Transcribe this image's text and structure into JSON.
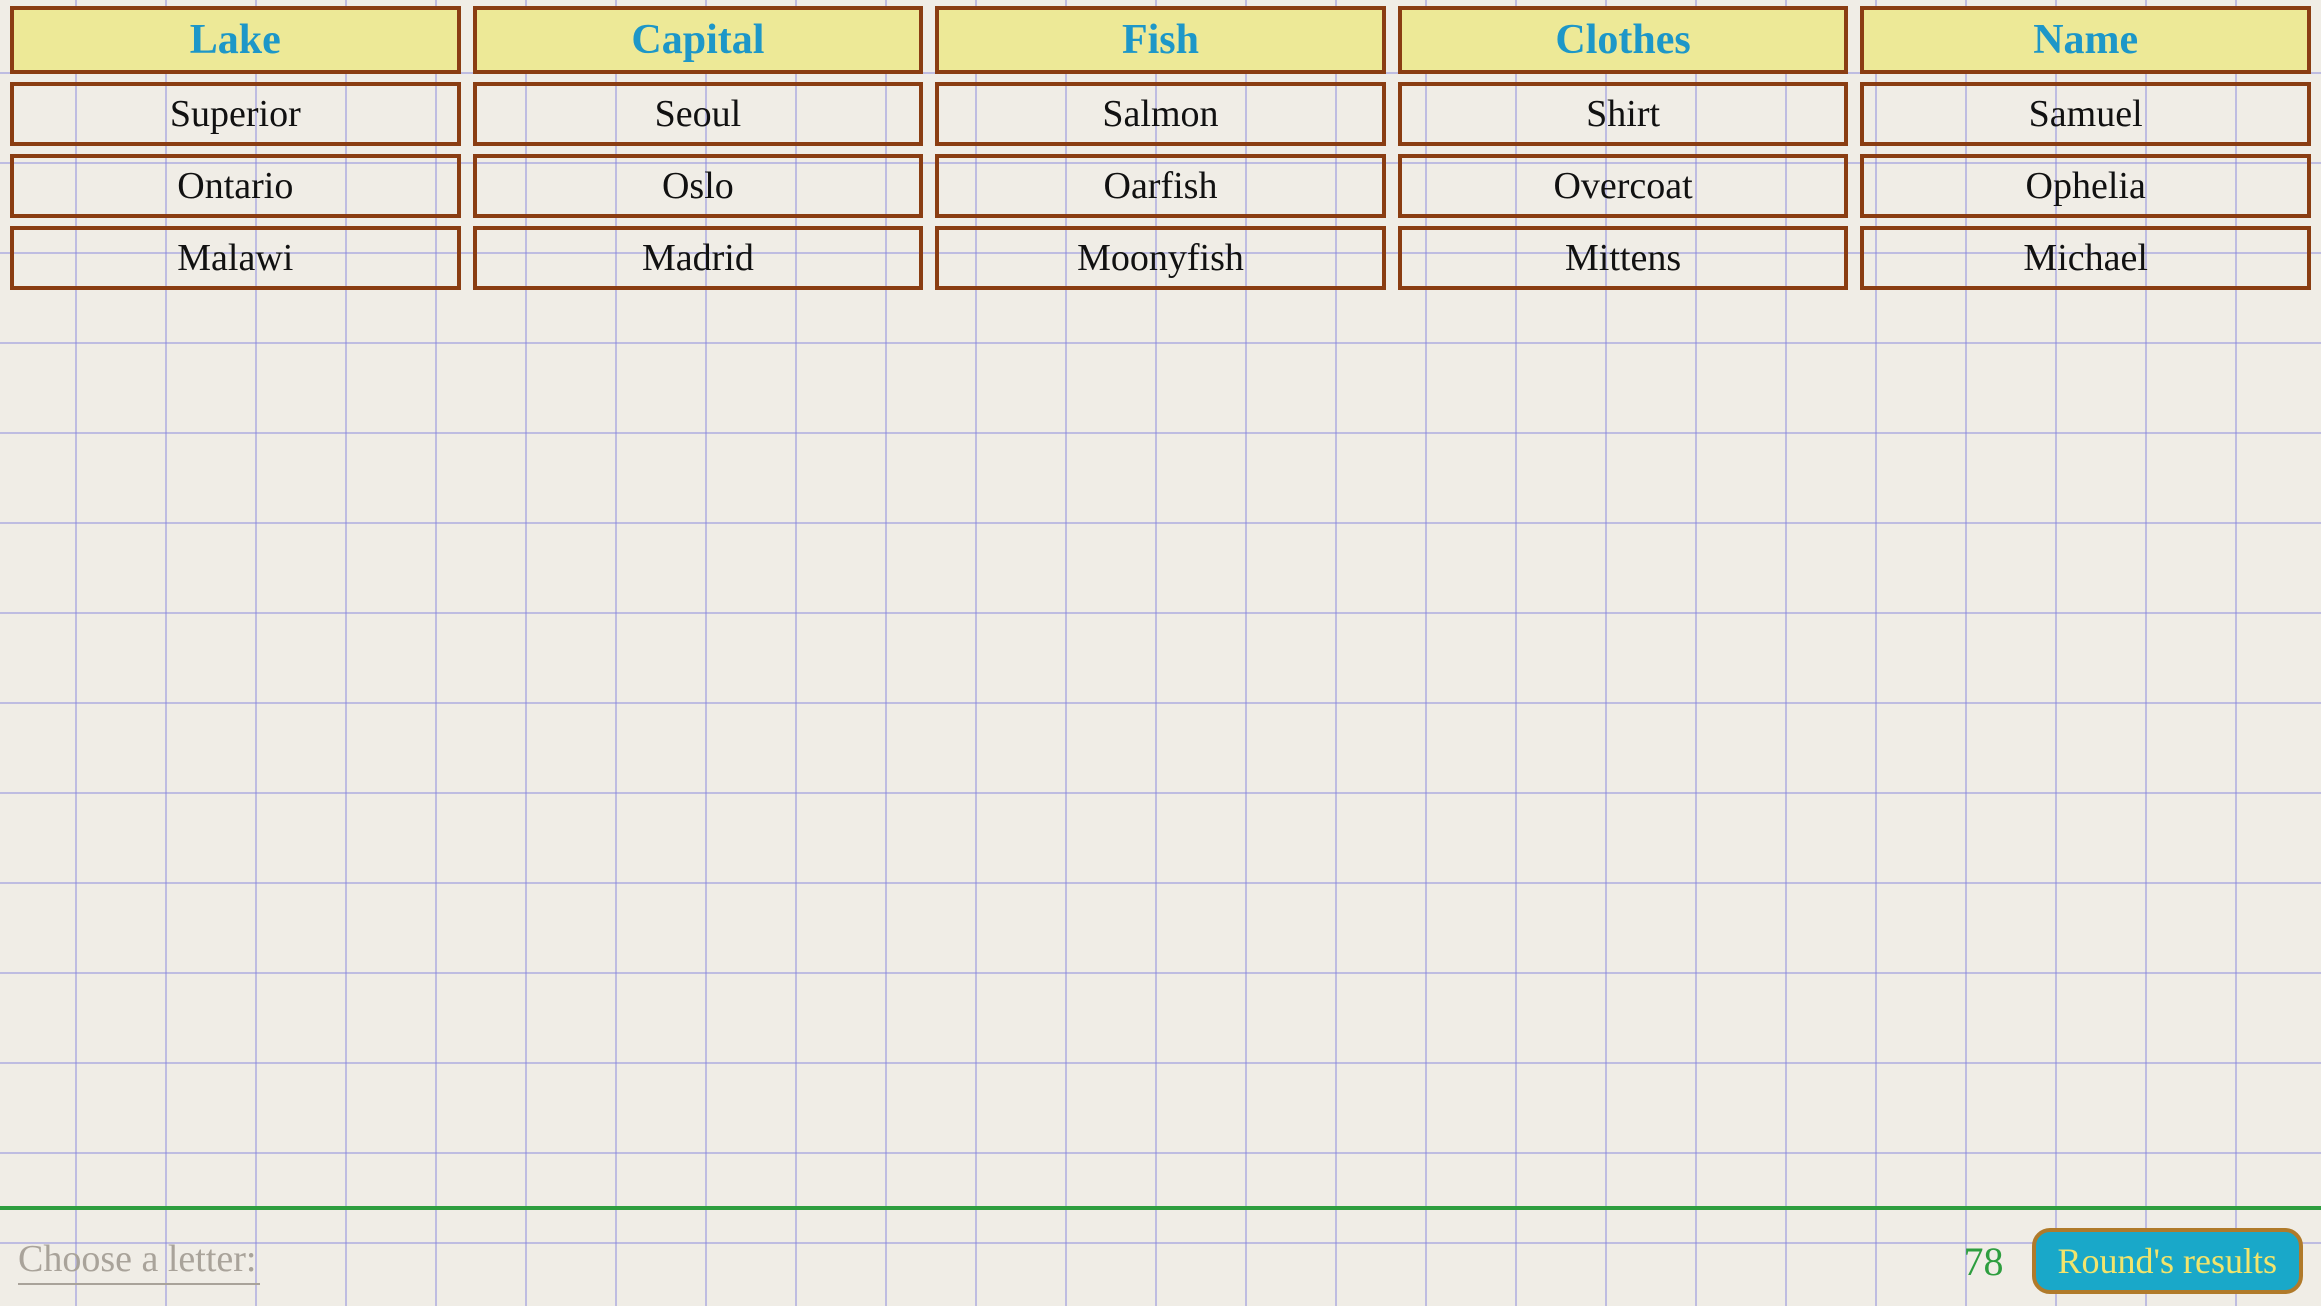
{
  "table": {
    "headers": [
      "Lake",
      "Capital",
      "Fish",
      "Clothes",
      "Name"
    ],
    "rows": [
      [
        "Superior",
        "Seoul",
        "Salmon",
        "Shirt",
        "Samuel"
      ],
      [
        "Ontario",
        "Oslo",
        "Oarfish",
        "Overcoat",
        "Ophelia"
      ],
      [
        "Malawi",
        "Madrid",
        "Moonyfish",
        "Mittens",
        "Michael"
      ]
    ]
  },
  "footer": {
    "choose_letter_label": "Choose a letter:",
    "score": "78",
    "results_button_label": "Round's results"
  }
}
